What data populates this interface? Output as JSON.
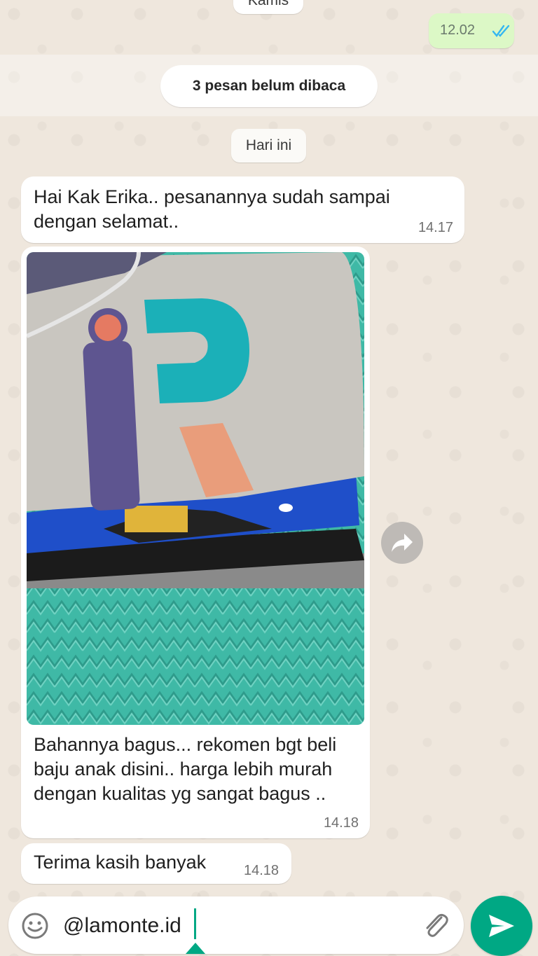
{
  "chat": {
    "day_previous": "Kamis",
    "outgoing_time": "12.02",
    "unread_banner": "3 pesan belum dibaca",
    "day_today": "Hari ini",
    "messages": [
      {
        "text": "Hai Kak Erika.. pesanannya sudah sampai dengan selamat..",
        "time": "14.17"
      },
      {
        "text": "Bahannya bagus... rekomen bgt beli baju anak disini.. harga lebih murah dengan kualitas yg sangat bagus ..",
        "time": "14.18"
      },
      {
        "text": "Terima kasih banyak",
        "time": "14.18"
      }
    ]
  },
  "compose": {
    "value": "@lamonte.id"
  },
  "icons": {
    "read_receipt": "double-check-icon",
    "forward": "forward-icon",
    "emoji": "emoji-icon",
    "attach": "paperclip-icon",
    "send": "send-icon"
  },
  "colors": {
    "accent": "#00a884",
    "outgoing_bubble": "#dcf8c6",
    "read_tick": "#34b7f1",
    "chat_bg": "#efe7dd"
  }
}
